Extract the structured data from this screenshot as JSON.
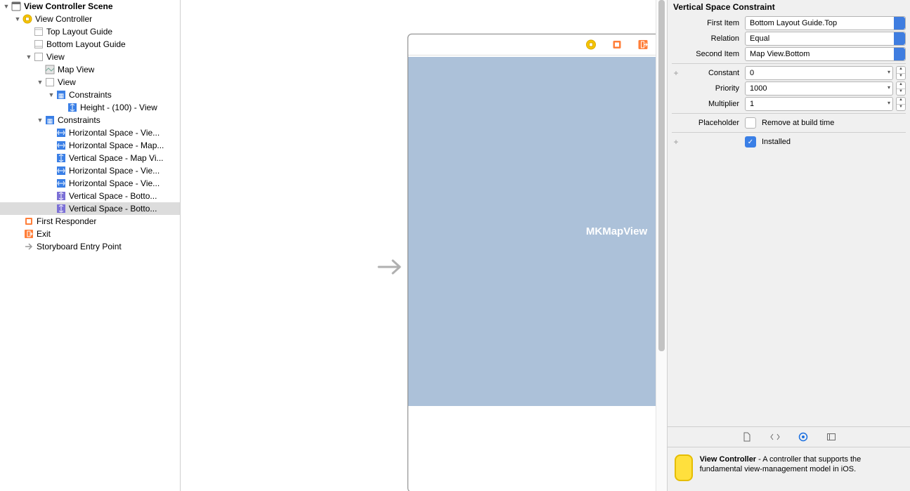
{
  "outline": {
    "scene": "View Controller Scene",
    "vc": "View Controller",
    "topGuide": "Top Layout Guide",
    "bottomGuide": "Bottom Layout Guide",
    "view": "View",
    "mapView": "Map View",
    "innerView": "View",
    "innerConstraints": "Constraints",
    "heightConstraint": "Height - (100) - View",
    "constraints": "Constraints",
    "c1": "Horizontal Space - Vie...",
    "c2": "Horizontal Space - Map...",
    "c3": "Vertical Space - Map Vi...",
    "c4": "Horizontal Space - Vie...",
    "c5": "Horizontal Space - Vie...",
    "c6": "Vertical Space - Botto...",
    "c7": "Vertical Space - Botto...",
    "firstResponder": "First Responder",
    "exit": "Exit",
    "entryPoint": "Storyboard Entry Point"
  },
  "canvas": {
    "mapLabel": "MKMapView"
  },
  "inspector": {
    "title": "Vertical Space Constraint",
    "labels": {
      "firstItem": "First Item",
      "relation": "Relation",
      "secondItem": "Second Item",
      "constant": "Constant",
      "priority": "Priority",
      "multiplier": "Multiplier",
      "placeholder": "Placeholder",
      "removeAtBuild": "Remove at build time",
      "installed": "Installed"
    },
    "values": {
      "firstItem": "Bottom Layout Guide.Top",
      "relation": "Equal",
      "secondItem": "Map View.Bottom",
      "constant": "0",
      "priority": "1000",
      "multiplier": "1"
    }
  },
  "help": {
    "title": "View Controller",
    "body": " - A controller that supports the fundamental view-management model in iOS."
  }
}
